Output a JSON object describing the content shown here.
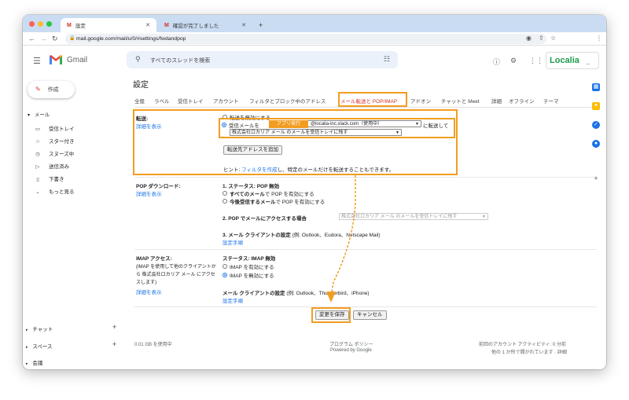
{
  "browser": {
    "tabs": [
      {
        "label": "設定",
        "active": true
      },
      {
        "label": "確認が完了しました",
        "active": false
      }
    ],
    "new_tab_glyph": "+",
    "url": "mail.google.com/mail/u/0/#settings/fwdandpop"
  },
  "gmail": {
    "logo_text": "Gmail",
    "search_placeholder": "すべてのスレッドを検索",
    "brand": "Localia",
    "brand_suffix": "_"
  },
  "nav": {
    "compose": "作成",
    "mail_header": "メール",
    "items": [
      {
        "icon": "inbox-icon",
        "label": "受信トレイ"
      },
      {
        "icon": "star-icon",
        "label": "スター付き"
      },
      {
        "icon": "clock-icon",
        "label": "スヌーズ中"
      },
      {
        "icon": "send-icon",
        "label": "送信済み"
      },
      {
        "icon": "draft-icon",
        "label": "下書き"
      },
      {
        "icon": "chevron-down-icon",
        "label": "もっと見る"
      }
    ],
    "chat": "チャット",
    "spaces": "スペース",
    "meet": "会議"
  },
  "settings": {
    "title": "設定",
    "tabs": [
      "全般",
      "ラベル",
      "受信トレイ",
      "アカウント",
      "フィルタとブロック中のアドレス",
      "メール転送と POP/IMAP",
      "アドオン",
      "チャットと Meet",
      "詳細",
      "オフライン",
      "テーマ"
    ],
    "active_tab_index": 5,
    "forwarding": {
      "label": "転送:",
      "details_link": "詳細を表示",
      "option_disable": "転送を無効にする",
      "option_enable_prefix": "受信メールを",
      "badge": "アプリ発行",
      "address_value": "@localia-inc.slack.com（使用中）",
      "forward_to_suffix": "に転送して",
      "keep_option": "株式会社ロカリア メール のメールを受信トレイに残す",
      "add_button": "転送先アドレスを追加",
      "hint_prefix": "ヒント:",
      "hint_link": "フィルタを作成",
      "hint_suffix": "し、特定のメールだけを転送することもできます。"
    },
    "pop": {
      "label": "POP ダウンロード:",
      "details_link": "詳細を表示",
      "status": "1. ステータス: POP 無効",
      "option_all_bold": "すべてのメール",
      "option_all_rest": "で POP を有効にする",
      "option_new_bold": "今後受信するメール",
      "option_new_rest": "で POP を有効にする",
      "access_label": "2. POP でメールにアクセスする場合",
      "access_value": "株式会社ロカリア メール のメールを受信トレイに残す",
      "client_label": "3. メール クライアントの設定",
      "client_example": "(例: Outlook、Eudora、Netscape Mail)",
      "setup_link": "設定手順"
    },
    "imap": {
      "label": "IMAP アクセス:",
      "desc": [
        "(IMAP を使用して他のクライアントか",
        "ら 株式会社ロカリア メール にアクセ",
        "スします)"
      ],
      "details_link": "詳細を表示",
      "status": "ステータス: IMAP 無効",
      "option_enable": "IMAP を有効にする",
      "option_disable": "IMAP を無効にする",
      "client_label": "メール クライアントの設定",
      "client_example": "(例: Outlook、Thunderbird、iPhone)",
      "setup_link": "設定手順"
    },
    "save_button": "変更を保存",
    "cancel_button": "キャンセル"
  },
  "footer": {
    "storage": "0.01 GB を使用中",
    "policy": "プログラム ポリシー",
    "powered": "Powered by Google",
    "activity": "前回のアカウント アクティビティ: 0 分前",
    "other": "他の 1 か所で開かれています · 詳細"
  },
  "colors": {
    "highlight": "#f29d22",
    "link": "#1a73e8",
    "brand_green": "#1e9b4f"
  }
}
